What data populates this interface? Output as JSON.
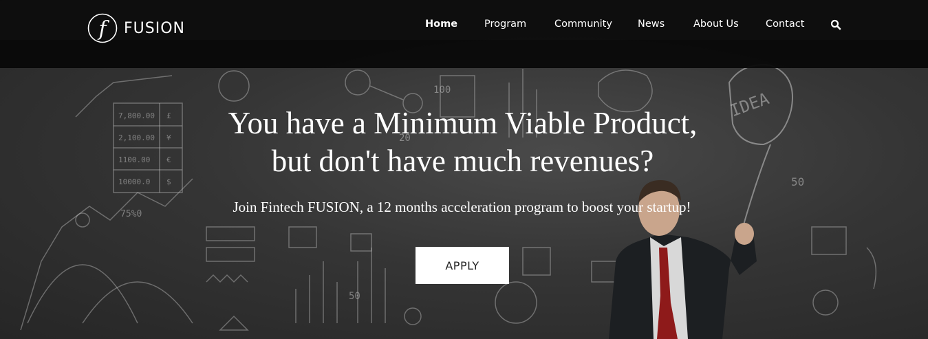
{
  "brand": {
    "name": "FUSION",
    "logo_letter": "f"
  },
  "nav": {
    "items": [
      {
        "label": "Home",
        "active": true
      },
      {
        "label": "Program"
      },
      {
        "label": "Community"
      },
      {
        "label": "News"
      },
      {
        "label": "About Us"
      },
      {
        "label": "Contact"
      }
    ],
    "search_icon": "search-icon"
  },
  "hero": {
    "headline_line1": "You have a Minimum Viable Product,",
    "headline_line2": "but don't have much revenues?",
    "subheadline": "Join Fintech FUSION, a 12 months acceleration program to boost your startup!",
    "cta_label": "APPLY"
  },
  "background_text": {
    "t1": "7,800.00",
    "t2": "2,100.00",
    "t3": "1100.00",
    "t4": "10000.0",
    "c1": "£",
    "c2": "¥",
    "c3": "€",
    "c4": "$",
    "n100": "100",
    "n20": "20",
    "n50": "50",
    "n50b": "50",
    "n75": "75%0",
    "idea": "IDEA"
  },
  "colors": {
    "navbar": "#0c0c0c",
    "text": "#ffffff",
    "button_bg": "#ffffff",
    "button_text": "#222222"
  }
}
